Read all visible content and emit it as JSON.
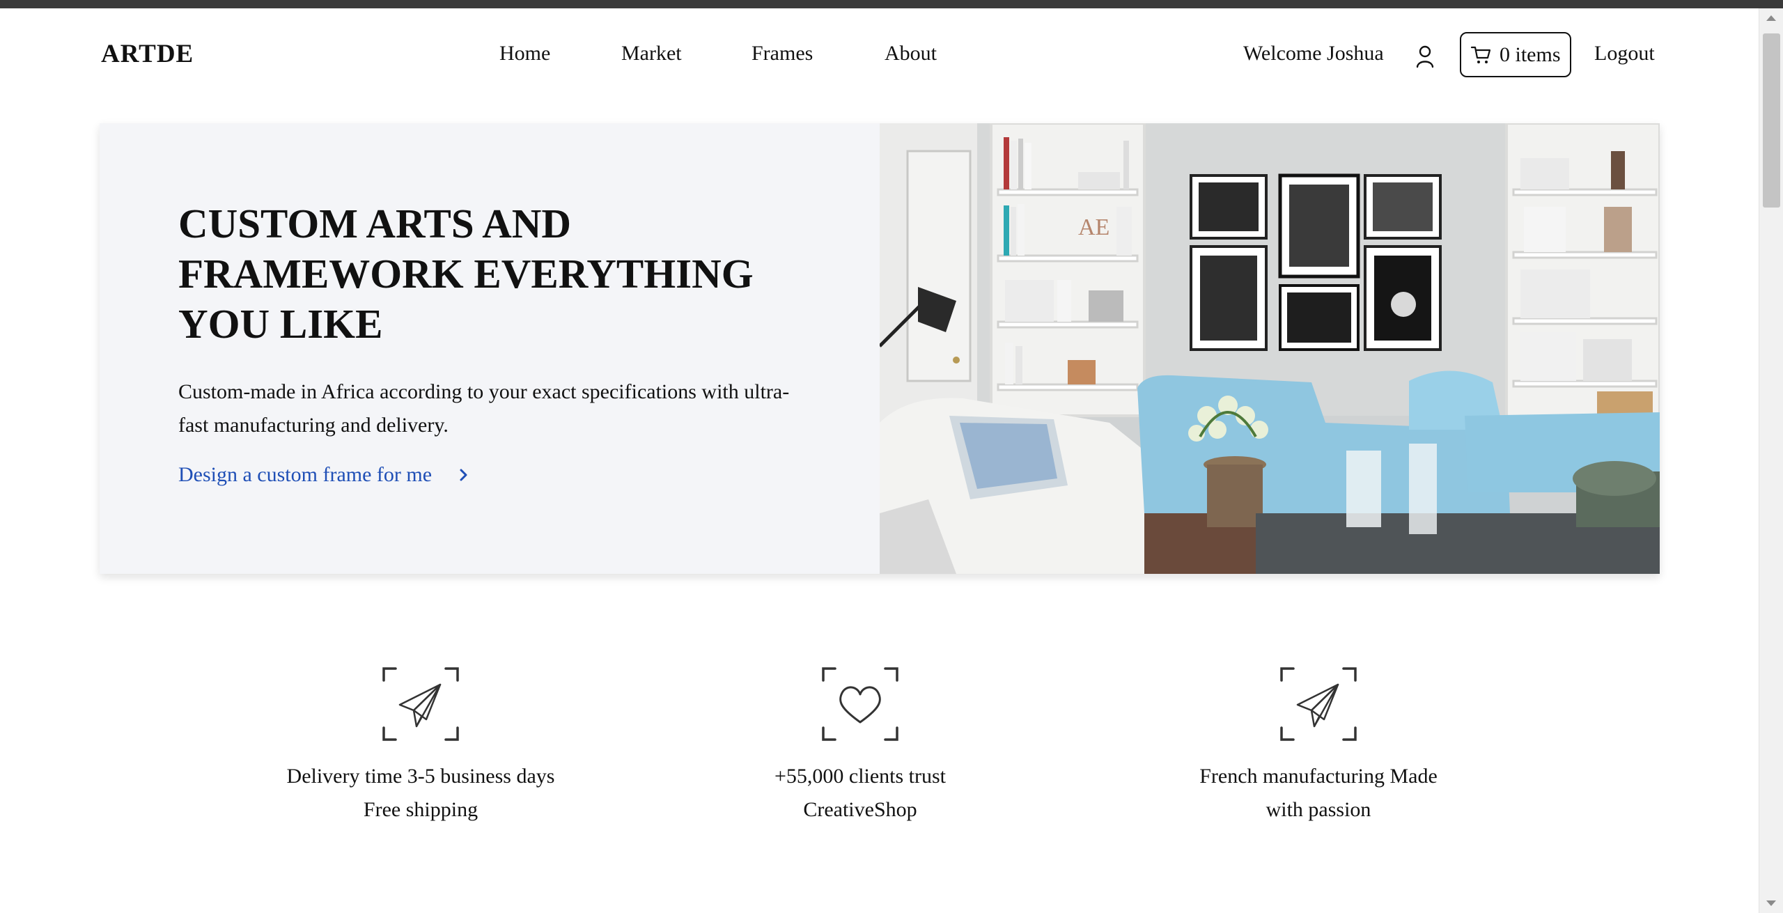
{
  "header": {
    "logo": "ARTDE",
    "nav": [
      {
        "label": "Home"
      },
      {
        "label": "Market"
      },
      {
        "label": "Frames"
      },
      {
        "label": "About"
      }
    ],
    "welcome": "Welcome Joshua",
    "user_icon": "user-icon",
    "cart": {
      "icon": "cart-icon",
      "label": "0 items"
    },
    "logout": "Logout"
  },
  "hero": {
    "title": "CUSTOM ARTS AND FRAMEWORK EVERYTHING YOU LIKE",
    "subtitle": "Custom-made in Africa according to your exact specifications with ultra-fast manufacturing and delivery.",
    "cta": "Design a custom frame for me",
    "cta_icon": "chevron-right-icon",
    "image": "living-room-photo",
    "bg_color": "#f4f5f8",
    "link_color": "#1f4fb6"
  },
  "features": [
    {
      "icon": "paper-plane-icon",
      "line1": "Delivery time 3-5 business days",
      "line2": "Free shipping"
    },
    {
      "icon": "heart-icon",
      "line1": "+55,000 clients trust",
      "line2": "CreativeShop"
    },
    {
      "icon": "paper-plane-icon",
      "line1": "French manufacturing Made",
      "line2": "with passion"
    }
  ]
}
